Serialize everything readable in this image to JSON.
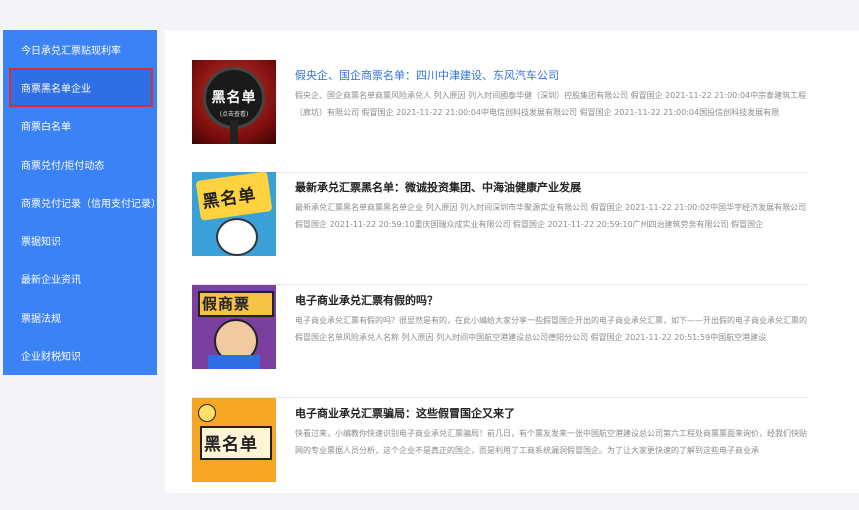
{
  "sidebar": {
    "items": [
      {
        "label": "今日承兑汇票贴现利率"
      },
      {
        "label": "商票黑名单企业"
      },
      {
        "label": "商票白名单"
      },
      {
        "label": "商票兑付/拒付动态"
      },
      {
        "label": "商票兑付记录（信用支付记录）"
      },
      {
        "label": "票据知识"
      },
      {
        "label": "最新企业资讯"
      },
      {
        "label": "票据法规"
      },
      {
        "label": "企业财税知识"
      }
    ]
  },
  "articles": [
    {
      "title": "假央企、国企商票名单：四川中津建设、东风汽车公司",
      "thumb_text": "黑名单",
      "thumb_sub": "(点击查看)",
      "excerpt": "假央企、国企商票名单商票风险承兑人 列入原因 列入时间國泰华健（深圳）控股集团有限公司 假冒国企 2021-11-22 21:00:04中宗泰建筑工程（廊坊）有限公司 假冒国企 2021-11-22 21:00:04中电信创科技发展有限公司 假冒国企 2021-11-22 21:00:04国投信创科技发展有限"
    },
    {
      "title": "最新承兑汇票黑名单：微诚投资集团、中海油健康产业发展",
      "thumb_text": "黑名单",
      "excerpt": "最新承兑汇票黑名单商票黑名单企业 列入原因 列入时间深圳市华聚源实业有限公司 假冒国企 2021-11-22 21:00:02中国华宇经济发展有限公司 假冒国企 2021-11-22 20:59:10重庆国瑞众成实业有限公司 假冒国企 2021-11-22 20:59:10广州四治建筑劳务有限公司 假冒国企"
    },
    {
      "title": "电子商业承兑汇票有假的吗？",
      "thumb_text": "假商票",
      "excerpt": "电子商业承兑汇票有假的吗？很显然是有的，在此小编给大家分享一些假冒国企开出的电子商业承兑汇票，如下——开出假的电子商业承兑汇票的假冒国企名单风险承兑人名称 列入原因 列入时间中国航空港建设总公司德阳分公司 假冒国企 2021-11-22 20:51:59中国航空港建设"
    },
    {
      "title": "电子商业承兑汇票骗局：这些假冒国企又来了",
      "thumb_text": "黑名单",
      "excerpt": "快看过来，小编教你快速识别电子商业承兑汇票骗局！前几日，有个票友发来一张中国航空港建设总公司第六工程处商票票面来询价，经我们快贴网的专业票据人员分析，这个企业不是真正的国企，而是利用了工商系统漏洞假冒国企。为了让大家更快速的了解到这些电子商业承"
    }
  ]
}
